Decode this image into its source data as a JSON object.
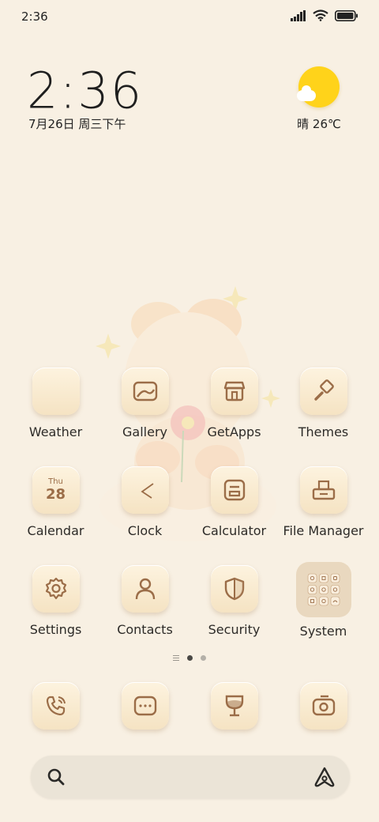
{
  "status_bar": {
    "time": "2:36"
  },
  "clock_widget": {
    "time": "2:36",
    "date": "7月26日 周三下午"
  },
  "weather_widget": {
    "text": "晴 26℃",
    "icon": "sun-cloud-icon"
  },
  "apps": [
    {
      "id": "weather",
      "label": "Weather",
      "icon": "blank-icon"
    },
    {
      "id": "gallery",
      "label": "Gallery",
      "icon": "image-icon"
    },
    {
      "id": "getapps",
      "label": "GetApps",
      "icon": "store-icon"
    },
    {
      "id": "themes",
      "label": "Themes",
      "icon": "brush-icon"
    },
    {
      "id": "calendar",
      "label": "Calendar",
      "icon": "calendar-icon",
      "day_abbr": "Thu",
      "day_num": "28"
    },
    {
      "id": "clock",
      "label": "Clock",
      "icon": "clock-icon"
    },
    {
      "id": "calculator",
      "label": "Calculator",
      "icon": "calculator-icon"
    },
    {
      "id": "filemanager",
      "label": "File Manager",
      "icon": "folder-icon"
    },
    {
      "id": "settings",
      "label": "Settings",
      "icon": "gear-icon"
    },
    {
      "id": "contacts",
      "label": "Contacts",
      "icon": "person-icon"
    },
    {
      "id": "security",
      "label": "Security",
      "icon": "shield-icon"
    },
    {
      "id": "system",
      "label": "System",
      "icon": "folder-grid-icon"
    }
  ],
  "dock": [
    {
      "id": "phone",
      "icon": "phone-icon"
    },
    {
      "id": "messages",
      "icon": "chat-icon"
    },
    {
      "id": "browser",
      "icon": "glass-icon"
    },
    {
      "id": "camera",
      "icon": "camera-icon"
    }
  ],
  "colors": {
    "background": "#f8f0e3",
    "icon_stroke": "#9b6d48",
    "sun": "#ffd31a"
  }
}
